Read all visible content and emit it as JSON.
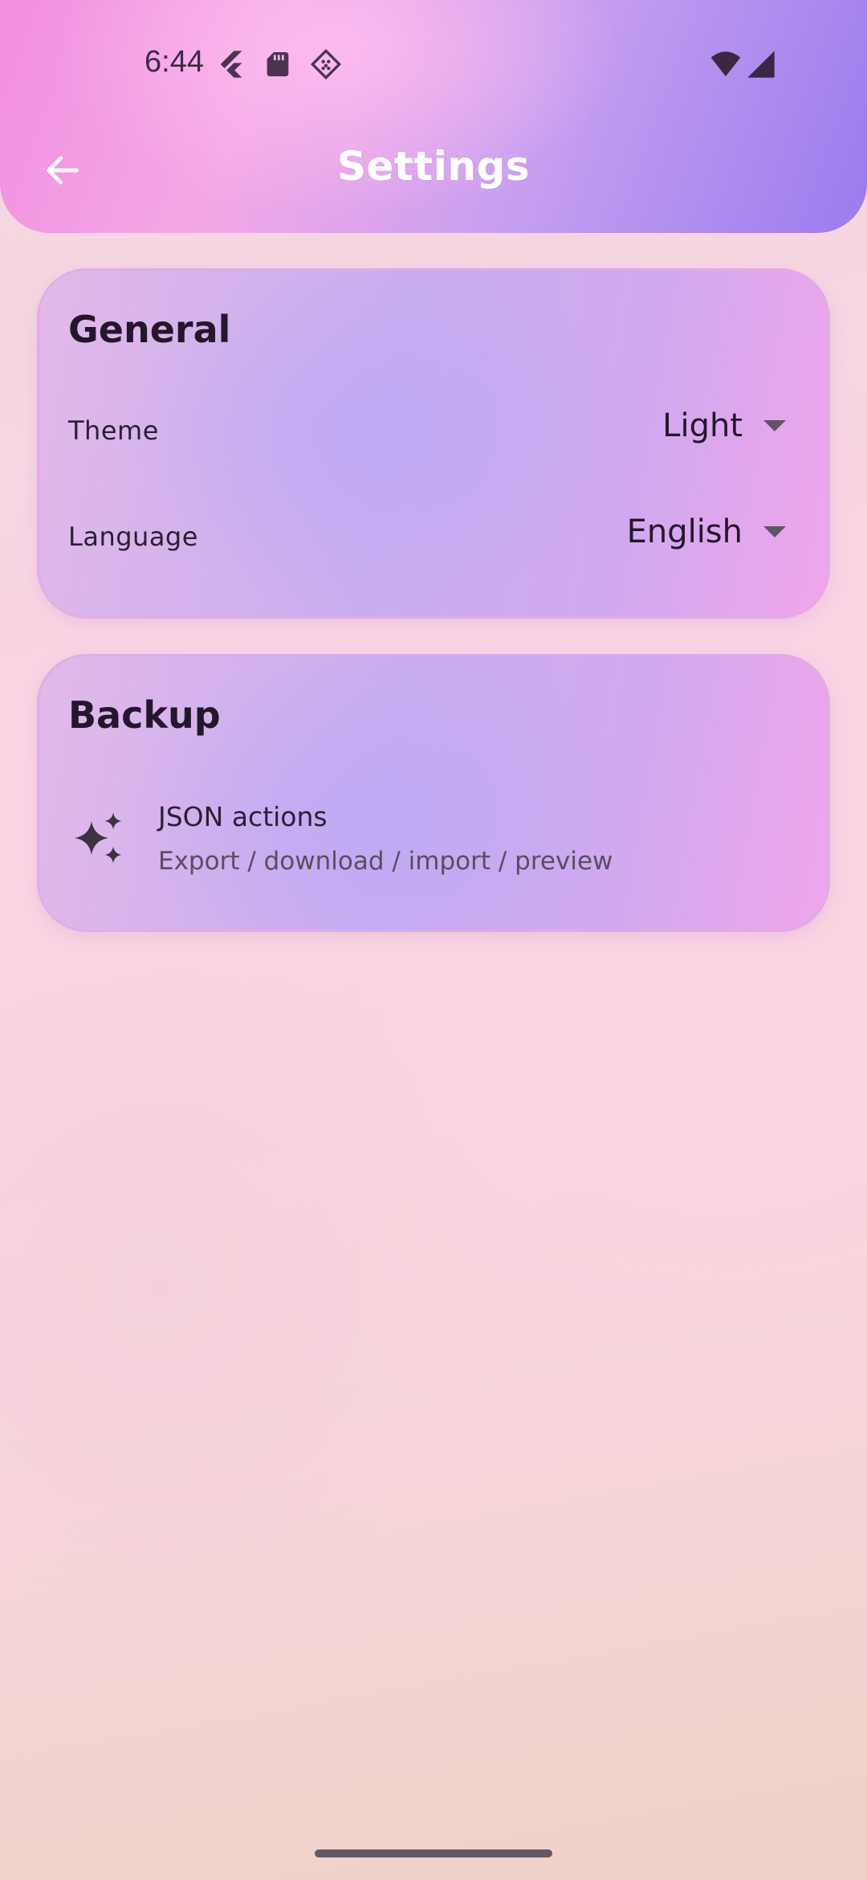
{
  "status_bar": {
    "time": "6:44",
    "icons_left": [
      "flutter-icon",
      "sd-card-icon",
      "app-badge-icon"
    ],
    "icons_right": [
      "wifi-icon",
      "cell-signal-icon"
    ]
  },
  "header": {
    "title": "Settings",
    "back_icon": "arrow-left-icon"
  },
  "general": {
    "title": "General",
    "theme_label": "Theme",
    "theme_value": "Light",
    "language_label": "Language",
    "language_value": "English"
  },
  "backup": {
    "title": "Backup",
    "item_icon": "sparkle-icon",
    "item_title": "JSON actions",
    "item_subtitle": "Export / download / import / preview"
  },
  "colors": {
    "header_gradient_start": "#f38fe0",
    "header_gradient_end": "#9a7cee",
    "card_tint": "#c9acef",
    "text_primary": "#25172b",
    "text_secondary": "#5a4d60"
  }
}
